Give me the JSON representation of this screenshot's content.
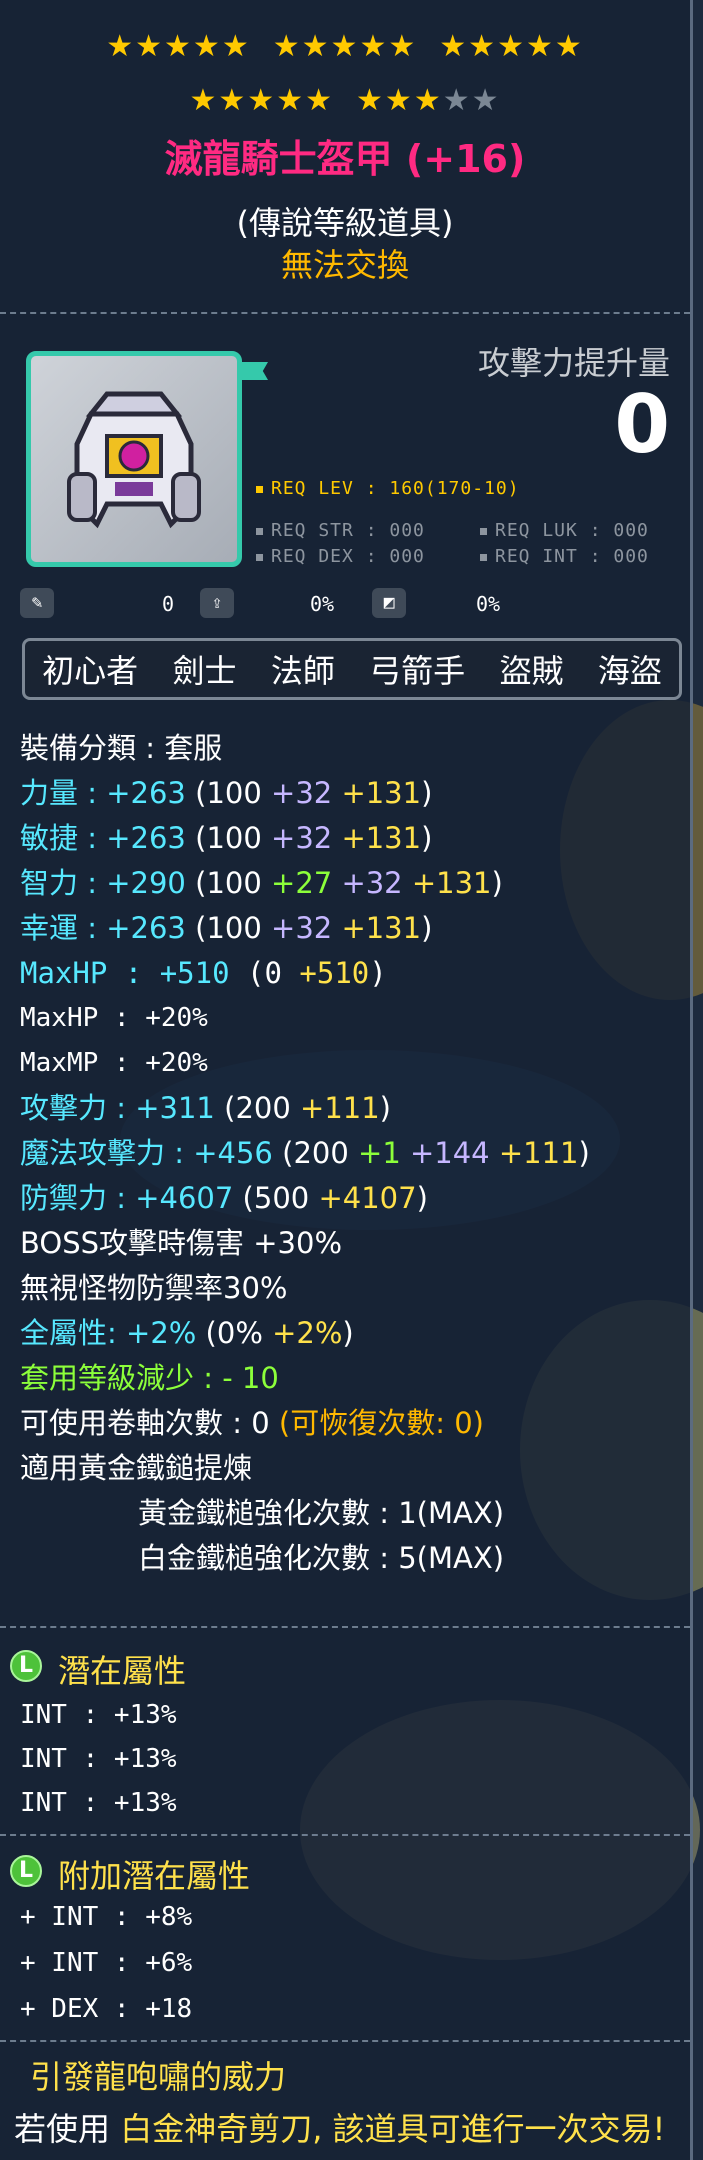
{
  "stars": {
    "row1": [
      1,
      1,
      1,
      1,
      1,
      0,
      1,
      1,
      1,
      1,
      1,
      0,
      1,
      1,
      1,
      1,
      1
    ],
    "row2_filled": 8,
    "row2_total": 10
  },
  "item": {
    "name": "滅龍騎士盔甲 (+16)",
    "grade": "(傳說等級道具)",
    "trade": "無法交換"
  },
  "attack_increase": {
    "label": "攻擊力提升量",
    "value": "0"
  },
  "requirements": {
    "lev": "REQ LEV : 160(170-10)",
    "str": "REQ STR : 000",
    "luk": "REQ LUK : 000",
    "dex": "REQ DEX : 000",
    "int": "REQ INT : 000"
  },
  "slots": {
    "a": "0",
    "b": "0%",
    "c": "0%"
  },
  "jobs": [
    "初心者",
    "劍士",
    "法師",
    "弓箭手",
    "盜賊",
    "海盜"
  ],
  "stats": {
    "category": "裝備分類 : 套服",
    "str": {
      "label": "力量",
      "total": "+263",
      "base": "100",
      "p1": "+32",
      "p2": "+131"
    },
    "dex": {
      "label": "敏捷",
      "total": "+263",
      "base": "100",
      "p1": "+32",
      "p2": "+131"
    },
    "int": {
      "label": "智力",
      "total": "+290",
      "base": "100",
      "p0": "+27",
      "p1": "+32",
      "p2": "+131"
    },
    "luk": {
      "label": "幸運",
      "total": "+263",
      "base": "100",
      "p1": "+32",
      "p2": "+131"
    },
    "maxhp": {
      "label": "MaxHP",
      "total": "+510",
      "base": "0",
      "p2": "+510"
    },
    "maxhp_pct": "MaxHP : +20%",
    "maxmp_pct": "MaxMP : +20%",
    "atk": {
      "label": "攻擊力",
      "total": "+311",
      "base": "200",
      "p2": "+111"
    },
    "matk": {
      "label": "魔法攻擊力",
      "total": "+456",
      "base": "200",
      "p0": "+1",
      "p1": "+144",
      "p2": "+111"
    },
    "def": {
      "label": "防禦力",
      "total": "+4607",
      "base": "500",
      "p2": "+4107"
    },
    "boss": "BOSS攻擊時傷害 +30%",
    "ignore_def": "無視怪物防禦率30%",
    "all_stat": {
      "label": "全屬性",
      "total": "+2%",
      "base": "0%",
      "p2": "+2%"
    },
    "level_reduce": "套用等級減少 : - 10",
    "scroll": "可使用卷軸次數 : 0",
    "scroll_restore": "(可恢復次數: 0)",
    "golden_hammer": "適用黃金鐵鎚提煉",
    "golden_count": "黃金鐵槌強化次數 : 1(MAX)",
    "platinum_count": "白金鐵槌強化次數 : 5(MAX)"
  },
  "potential": {
    "badge": "L",
    "title": "潛在屬性",
    "lines": [
      "INT : +13%",
      "INT : +13%",
      "INT : +13%"
    ]
  },
  "additional_potential": {
    "badge": "L",
    "title": "附加潛在屬性",
    "lines": [
      "+ INT : +8%",
      "+ INT : +6%",
      "+ DEX : +18"
    ]
  },
  "set_effect": {
    "title": "引發龍咆嘯的威力",
    "desc_prefix": "若使用",
    "desc_item": "白金神奇剪刀",
    "desc_suffix": ", 該道具可進行一次交易!"
  },
  "colors": {
    "name": "#ff2a82",
    "cyan": "#57e8ff",
    "yellow": "#ffe14b",
    "orange": "#ffb800",
    "teal_border": "#35c9ab"
  }
}
